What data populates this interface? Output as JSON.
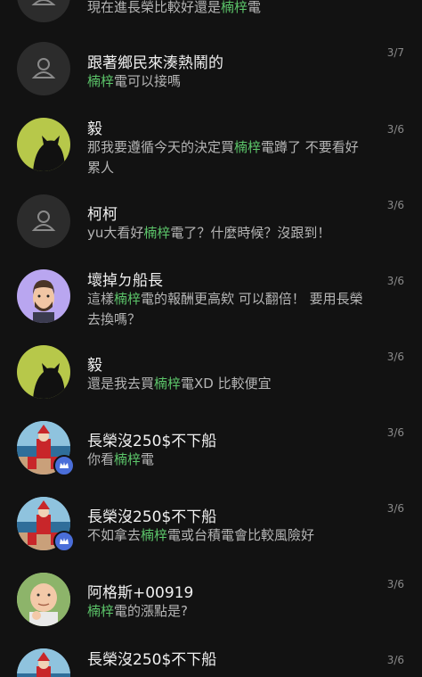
{
  "highlight_word": "楠梓",
  "colors": {
    "background": "#121212",
    "highlight": "#5cc56a",
    "badge": "#4a6ed9"
  },
  "items": [
    {
      "name": "",
      "date": "",
      "avatar": "gray-default-avatar",
      "msg_pre": "現在進長榮比較好還是",
      "msg_post": "電"
    },
    {
      "name": "跟著鄉民來湊熱鬧的",
      "date": "3/7",
      "avatar": "gray-default-avatar",
      "msg_pre": "",
      "msg_post": "電可以接嗎"
    },
    {
      "name": "毅",
      "date": "3/6",
      "avatar": "black-cat-avatar",
      "msg_pre": "那我要遵循今天的決定買",
      "msg_post": "電蹲了 不要看好累人"
    },
    {
      "name": "柯柯",
      "date": "3/6",
      "avatar": "gray-default-avatar",
      "msg_pre": "yu大看好",
      "msg_post": "電了？什麼時候？沒跟到！"
    },
    {
      "name": "壞掉ㄉ船長",
      "date": "3/6",
      "avatar": "bearded-man-avatar",
      "msg_pre": "這樣",
      "msg_post": "電的報酬更高欸 可以翻倍！ 要用長榮去換嗎？"
    },
    {
      "name": "毅",
      "date": "3/6",
      "avatar": "black-cat-avatar",
      "msg_pre": "還是我去買",
      "msg_post": "電XD 比較便宜"
    },
    {
      "name": "長榮沒250$不下船",
      "date": "3/6",
      "avatar": "santa-beach-avatar",
      "msg_pre": "你看",
      "msg_post": "電"
    },
    {
      "name": "長榮沒250$不下船",
      "date": "3/6",
      "avatar": "santa-beach-avatar",
      "msg_pre": "不如拿去",
      "msg_post": "電或台積電會比較風險好"
    },
    {
      "name": "阿格斯+00919",
      "date": "3/6",
      "avatar": "baby-fist-avatar",
      "msg_pre": "",
      "msg_post": "電的漲點是?"
    },
    {
      "name": "長榮沒250$不下船",
      "date": "3/6",
      "avatar": "santa-beach-avatar",
      "msg_pre": "",
      "msg_post": ""
    }
  ]
}
